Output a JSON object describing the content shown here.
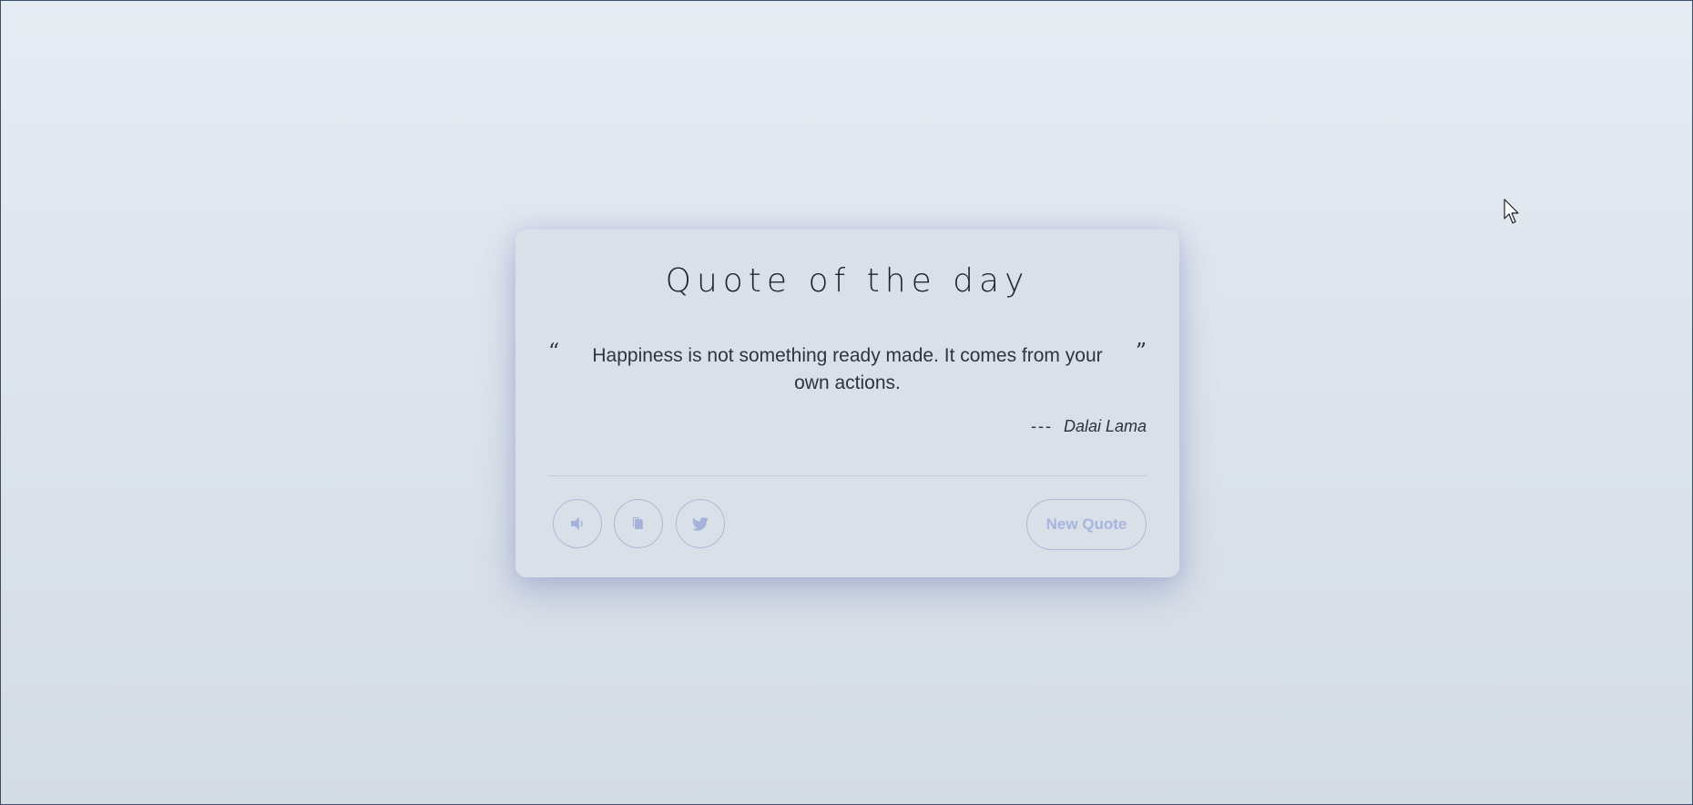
{
  "card": {
    "title": "Quote of the day",
    "open_quote": "“",
    "close_quote": "”",
    "quote": "Happiness is not something ready made. It comes from your own actions.",
    "author_prefix": "---",
    "author": "Dalai Lama"
  },
  "actions": {
    "sound_icon": "speaker-icon",
    "copy_icon": "copy-icon",
    "twitter_icon": "twitter-icon",
    "new_quote_label": "New Quote"
  },
  "colors": {
    "accent": "#a8b3e0",
    "text": "#2d3442"
  }
}
